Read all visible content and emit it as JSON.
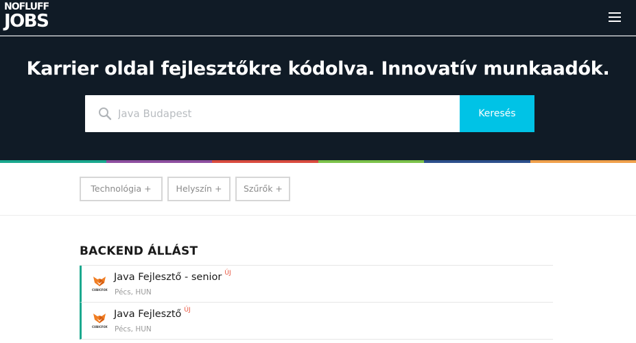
{
  "brand": {
    "logo_top": "NOFLUFF",
    "logo_bottom": "JOBS"
  },
  "nav": {
    "menu_icon": "hamburger-icon"
  },
  "hero": {
    "title": "Karrier oldal fejlesztőkre kódolva. Innovatív munkaadók.",
    "search_placeholder": "Java Budapest",
    "search_value": "",
    "search_icon": "search-icon",
    "search_button": "Keresés"
  },
  "colors": {
    "header_bg": "#101b26",
    "accent": "#00c3e6",
    "stripe": [
      "#1aa88e",
      "#8e4fa0",
      "#d94b3f",
      "#7cc24a",
      "#2c4f8c",
      "#f0a04b"
    ],
    "job_border": "#1aa88e",
    "new_badge": "#e8503a"
  },
  "filters": [
    {
      "label": "Technológia +"
    },
    {
      "label": "Helyszín +"
    },
    {
      "label": "Szűrők +"
    }
  ],
  "section": {
    "title": "BACKEND ÁLLÁST"
  },
  "jobs": [
    {
      "title": "Java Fejlesztő - senior",
      "badge": "ÚJ",
      "location": "Pécs, HUN",
      "company_logo_text": "CUBICFOX"
    },
    {
      "title": "Java Fejlesztő",
      "badge": "ÚJ",
      "location": "Pécs, HUN",
      "company_logo_text": "CUBICFOX"
    }
  ]
}
